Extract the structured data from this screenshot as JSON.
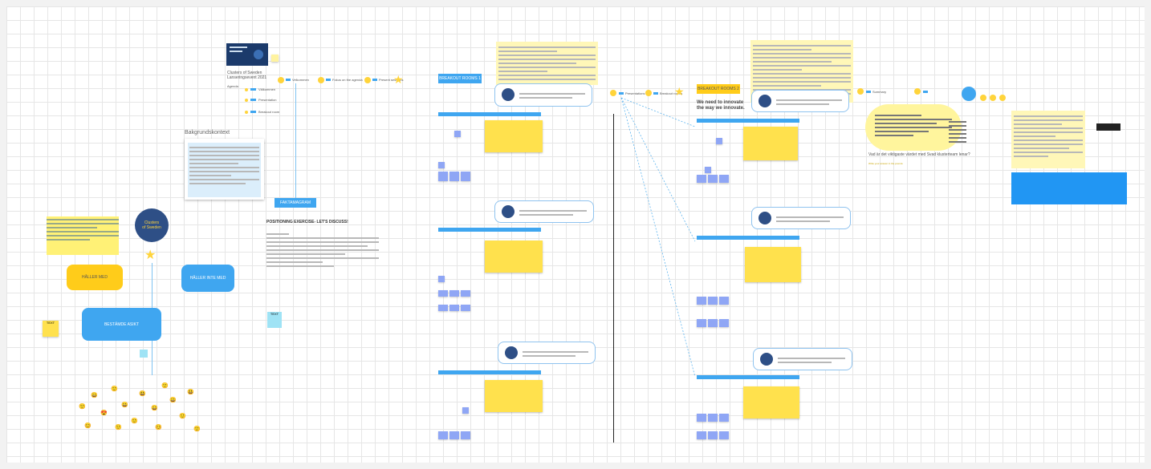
{
  "board": {
    "clusters_title": "Clusters of Sweden\nLanseringsevent 2021",
    "clusters_subtitle_label": "Clusters of Sweden",
    "bakgrund_title": "Bakgrundskontext",
    "positioning_title": "POSITIONING EXERCISE- LET'S DISCUSS!",
    "positioning_button": "FAKTAMAGRAM",
    "logo_text": "Clusters\nof Sweden",
    "haller_med": "HÅLLER MED",
    "haller_inte_med": "HÅLLER INTE MED",
    "bestamde_asikt": "BESTÄMDE ASIKT",
    "sticky_small_left": "TEXT",
    "sticky_small_mid": "TEXT",
    "breakout_1": "BREAKOUT ROOMS 1",
    "breakout_2": "BREAKOUT ROOMS 2",
    "innovate_heading": "We need to innovate\nthe way we innovate.",
    "question_text": "Vad är det viktigaste värdet med Svad klusterteam lenar?",
    "question_sub": "Write your answer in the post-its",
    "timeline_step_1": "Velkommen",
    "timeline_step_2": "Fokus on the agenda",
    "timeline_step_3": "Present sessions",
    "timeline_step_4": "Presentations",
    "timeline_step_5": "Breakout rooms",
    "timeline_step_6": "Summary",
    "agenda_1": "Välkommen",
    "agenda_2": "Presentation",
    "agenda_3": "Breakout room",
    "agenda_4": "Summering"
  },
  "colors": {
    "accent_blue": "#3fa6f0",
    "sticky_yellow": "#ffe14d",
    "sticky_purple": "#8fa6f5",
    "note_yellow": "#fff7b8",
    "navy": "#2e4f86"
  }
}
